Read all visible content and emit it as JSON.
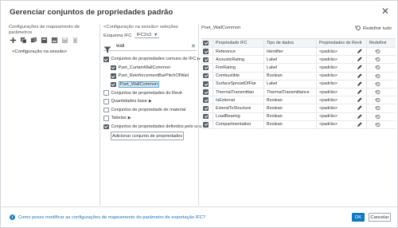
{
  "dialog": {
    "title": "Gerenciar conjuntos de propriedades padrão"
  },
  "left_pane": {
    "header": "Configurações de mapeamento de parâmetros",
    "toolbar_icons": [
      "add-icon",
      "duplicate-icon",
      "copy-icon",
      "import-icon",
      "export-icon",
      "save-icon",
      "delete-icon"
    ],
    "session_item": "<Configuração na sessão>"
  },
  "middle_pane": {
    "header": "<Configuração na sessão> seleções",
    "schema_label": "Esquema IFC",
    "schema_value": "IFC2x3",
    "search_value": "wall",
    "tree": [
      {
        "label": "Conjuntos de propriedades comuns de IFC",
        "checked": true,
        "indent": false,
        "caret": true,
        "selected": false
      },
      {
        "label": "Pset_CurtainWallCommon",
        "checked": true,
        "indent": true,
        "caret": false,
        "selected": false
      },
      {
        "label": "Pset_ReinforcementBarPitchOfWall",
        "checked": true,
        "indent": true,
        "caret": false,
        "selected": false
      },
      {
        "label": "Pset_WallCommon",
        "checked": true,
        "indent": true,
        "caret": false,
        "selected": true
      },
      {
        "label": "Conjuntos de propriedades do Revit",
        "checked": false,
        "indent": false,
        "caret": false,
        "selected": false
      },
      {
        "label": "Quantidades base",
        "checked": false,
        "indent": false,
        "caret": true,
        "selected": false
      },
      {
        "label": "Conjuntos de propriedade de material",
        "checked": false,
        "indent": false,
        "caret": false,
        "selected": false
      },
      {
        "label": "Tabelas",
        "checked": false,
        "indent": false,
        "caret": true,
        "selected": false
      },
      {
        "label": "Conjuntos de propriedades definidos pelo usu",
        "checked": true,
        "indent": false,
        "caret": false,
        "selected": false
      }
    ],
    "add_button": "Adicionar conjunto de propriedades"
  },
  "right_pane": {
    "pset_title": "Pset_WallCommon",
    "reset_all": "Redefinir tudo",
    "columns": [
      "Propriedade IFC",
      "Tipo de dados",
      "Propriedades do Revit",
      "Redefinir"
    ],
    "rows": [
      {
        "prop": "Reference",
        "type": "Identifier",
        "revit": "<padrão>"
      },
      {
        "prop": "AcousticRating",
        "type": "Label",
        "revit": "<padrão>"
      },
      {
        "prop": "FireRating",
        "type": "Label",
        "revit": "<padrão>"
      },
      {
        "prop": "Combustible",
        "type": "Boolean",
        "revit": "<padrão>"
      },
      {
        "prop": "SurfaceSpreadOfFlar",
        "type": "Label",
        "revit": "<padrão>"
      },
      {
        "prop": "ThermalTransmittan",
        "type": "ThermalTransmittance",
        "revit": "<padrão>"
      },
      {
        "prop": "IsExternal",
        "type": "Boolean",
        "revit": "<padrão>"
      },
      {
        "prop": "ExtendToStructure",
        "type": "Boolean",
        "revit": "<padrão>"
      },
      {
        "prop": "LoadBearing",
        "type": "Boolean",
        "revit": "<padrão>"
      },
      {
        "prop": "Compartmentation",
        "type": "Boolean",
        "revit": "<padrão>"
      }
    ]
  },
  "footer": {
    "help_text": "Como posso modificar as configurações de mapeamento do parâmetro de exportação IFC?",
    "ok": "OK",
    "cancel": "Cancelar"
  },
  "colors": {
    "accent": "#0f7ac2",
    "selected_bg": "#d9ecf7",
    "selected_border": "#57a9d8"
  }
}
